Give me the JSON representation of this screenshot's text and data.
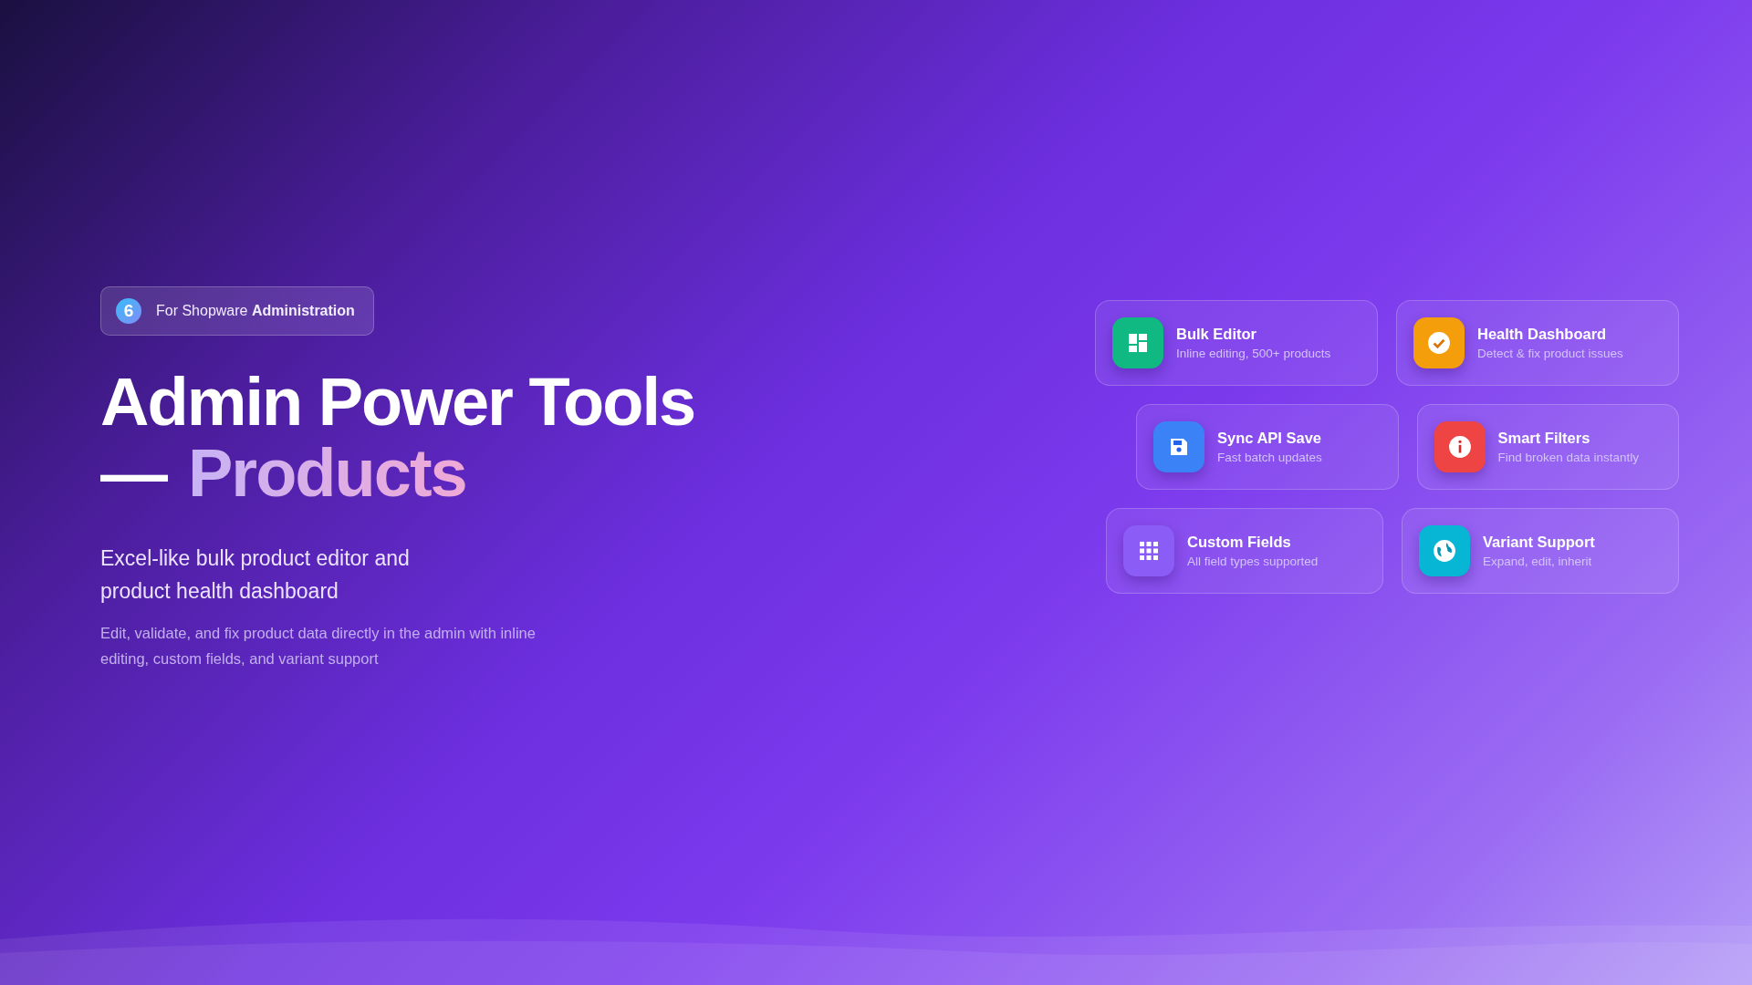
{
  "badge": {
    "logo": "6",
    "prefix": "For Shopware",
    "strong": "Administration"
  },
  "title": {
    "line_1": "Admin Power Tools",
    "dash": "—",
    "highlight": "Products"
  },
  "subtitle": "Excel-like bulk product editor and product health dashboard",
  "description": "Edit, validate, and fix product data directly in the admin with inline editing, custom fields, and variant support",
  "feature_rows": [
    {
      "cards": [
        {
          "kind": "layout",
          "color": "#10b981",
          "title": "Bulk Editor",
          "text": "Inline editing, 500+ products"
        },
        {
          "kind": "check",
          "color": "#f59e0b",
          "title": "Health Dashboard",
          "text": "Detect & fix product issues"
        }
      ]
    },
    {
      "cards": [
        {
          "kind": "save",
          "color": "#3b82f6",
          "title": "Sync API Save",
          "text": "Fast batch updates"
        },
        {
          "kind": "info",
          "color": "#ef4444",
          "title": "Smart Filters",
          "text": "Find broken data instantly"
        }
      ]
    },
    {
      "cards": [
        {
          "kind": "grid",
          "color": "#8b5cf6",
          "title": "Custom Fields",
          "text": "All field types supported"
        },
        {
          "kind": "globe",
          "color": "#06b6d4",
          "title": "Variant Support",
          "text": "Expand, edit, inherit"
        }
      ]
    }
  ]
}
